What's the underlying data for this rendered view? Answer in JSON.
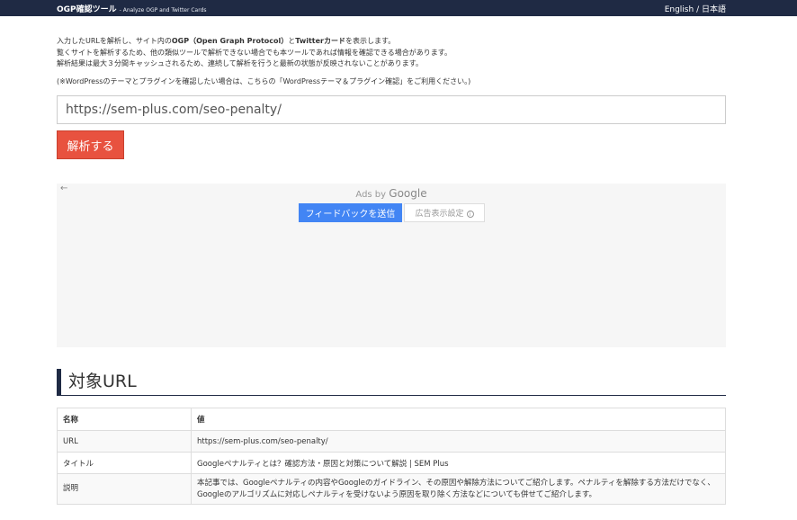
{
  "header": {
    "brand": "OGP確認ツール",
    "brand_sub": "- Analyze OGP and Twitter Cards",
    "lang_en": "English",
    "lang_sep": "/",
    "lang_ja": "日本語"
  },
  "intro": {
    "line1_a": "入力したURLを解析し、サイト内の",
    "line1_b": "OGP（Open Graph Protocol）",
    "line1_c": "と",
    "line1_d": "Twitterカード",
    "line1_e": "を表示します。",
    "line2": "覧くサイトを解析するため、他の類似ツールで解析できない場合でも本ツールであれば情報を確認できる場合があります。",
    "line3": "解析結果は最大３分間キャッシュされるため、連続して解析を行うと最新の状態が反映されないことがあります。"
  },
  "note": {
    "prefix": "(※WordPressのテーマとプラグインを確認したい場合は、こちらの",
    "link": "「WordPressテーマ＆プラグイン確認」",
    "suffix": "をご利用ください。)"
  },
  "form": {
    "url_value": "https://sem-plus.com/seo-penalty/",
    "analyze_label": "解析する"
  },
  "ad": {
    "back": "←",
    "ads_by": "Ads by",
    "google": "Google",
    "feedback_label": "フィードバックを送信",
    "settings_label": "広告表示設定",
    "info_glyph": "i"
  },
  "section": {
    "title": "対象URL"
  },
  "table": {
    "header_name": "名称",
    "header_value": "値",
    "rows": [
      {
        "name": "URL",
        "value": "https://sem-plus.com/seo-penalty/"
      },
      {
        "name": "タイトル",
        "value": "Googleペナルティとは？確認方法・原因と対策について解説 | SEM Plus"
      },
      {
        "name": "説明",
        "value": "本記事では、Googleペナルティの内容やGoogleのガイドライン、その原因や解除方法についてご紹介します。ペナルティを解除する方法だけでなく、Googleのアルゴリズムに対応しペナルティを受けないよう原因を取り除く方法などについても併せてご紹介します。"
      }
    ]
  },
  "colors": {
    "navbar": "#1f2a44",
    "analyze_button": "#e8523f",
    "feedback_button": "#4285f4"
  }
}
